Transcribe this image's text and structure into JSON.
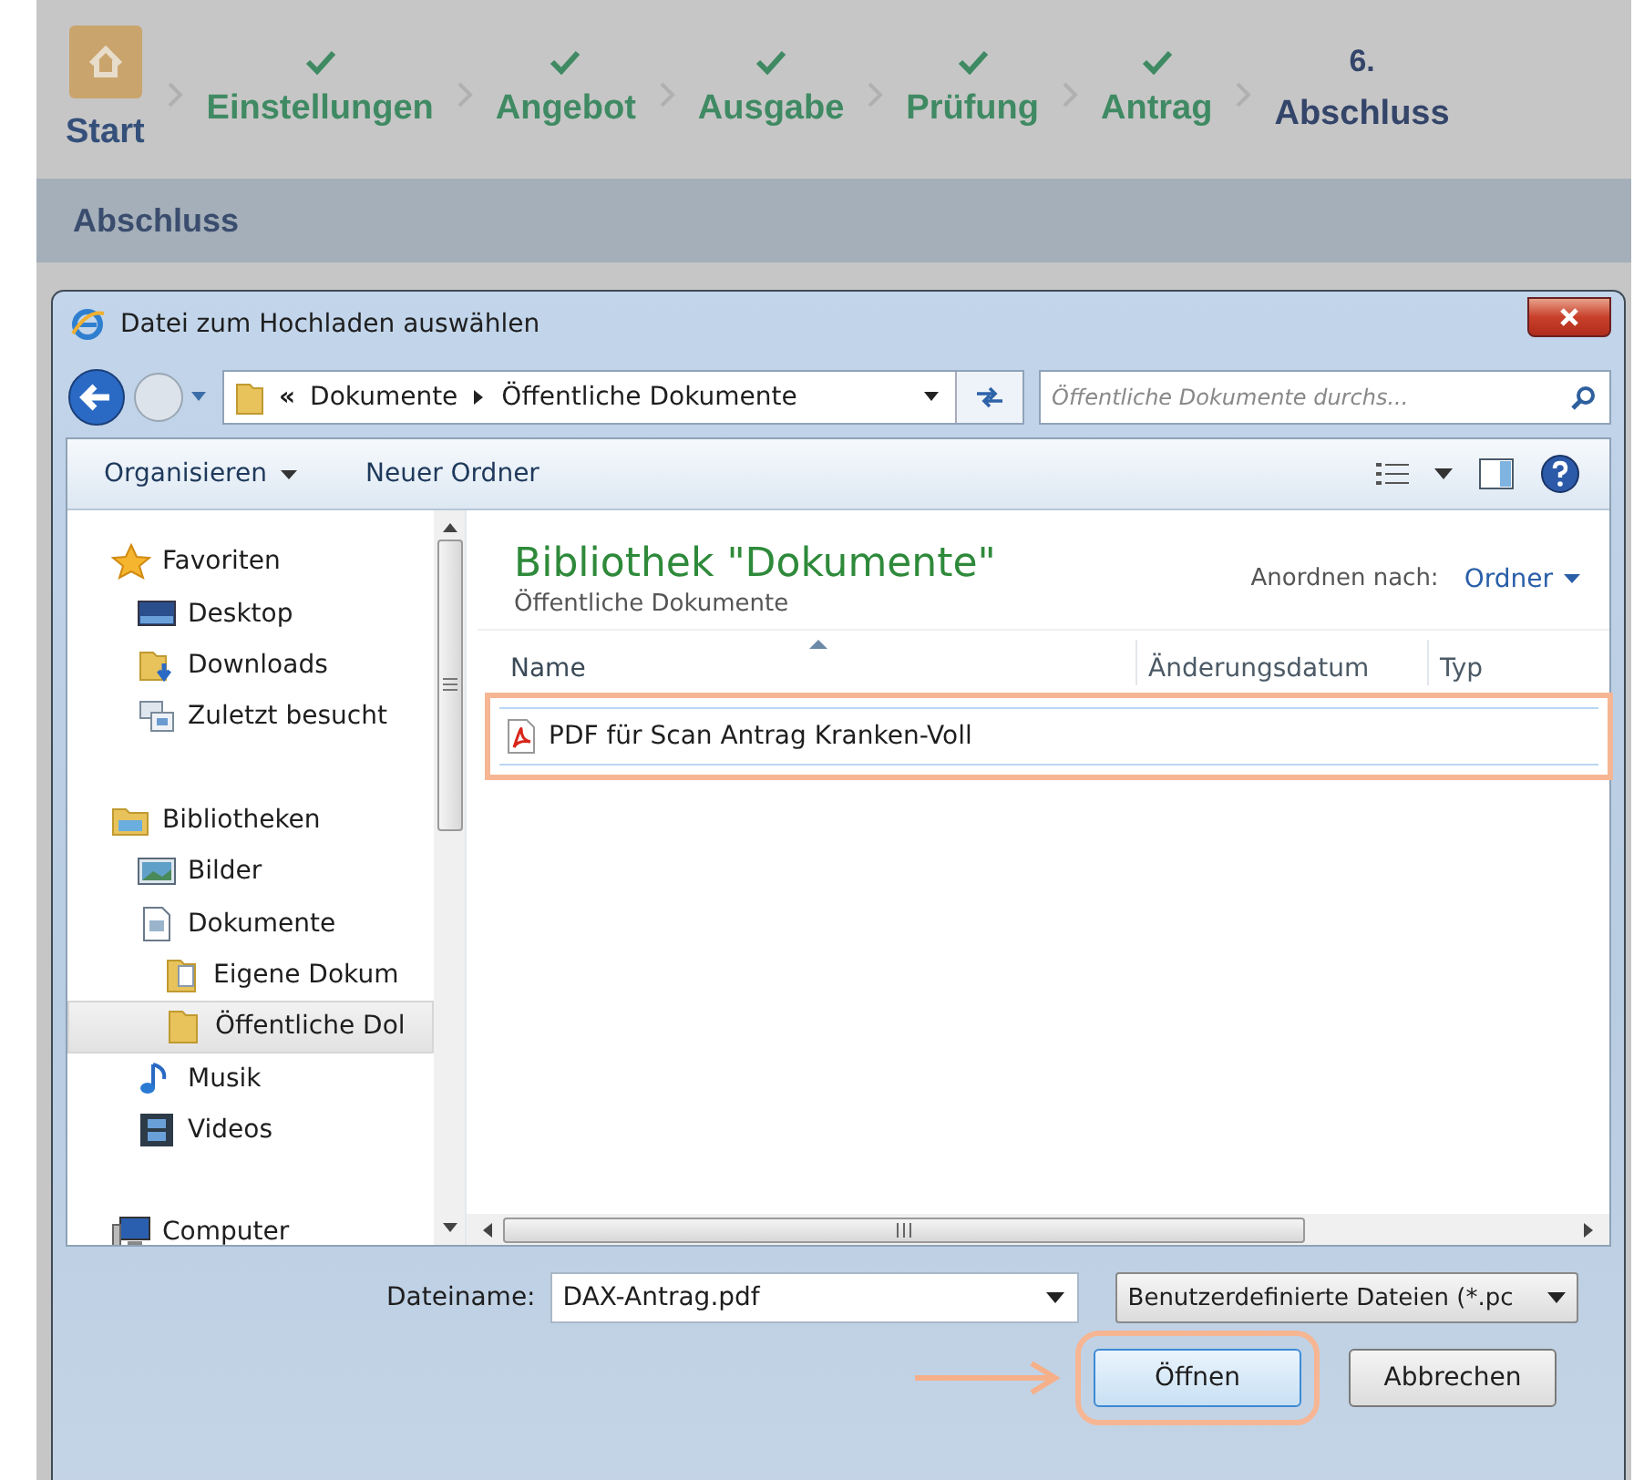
{
  "stepper": {
    "steps": [
      {
        "kind": "home",
        "label": "Start"
      },
      {
        "kind": "done",
        "label": "Einstellungen"
      },
      {
        "kind": "done",
        "label": "Angebot"
      },
      {
        "kind": "done",
        "label": "Ausgabe"
      },
      {
        "kind": "done",
        "label": "Prüfung"
      },
      {
        "kind": "done",
        "label": "Antrag"
      },
      {
        "kind": "current",
        "number": "6.",
        "label": "Abschluss"
      }
    ]
  },
  "section": {
    "title": "Abschluss"
  },
  "dialog": {
    "title": "Datei zum Hochladen auswählen",
    "address": {
      "overflow_mark": "«",
      "segments": [
        "Dokumente",
        "Öffentliche Dokumente"
      ]
    },
    "search": {
      "placeholder": "Öffentliche Dokumente durchs..."
    },
    "toolbar": {
      "organize": "Organisieren",
      "new_folder": "Neuer Ordner"
    },
    "nav": [
      {
        "label": "Favoriten",
        "selected": false,
        "children": [
          {
            "label": "Desktop",
            "selected": false
          },
          {
            "label": "Downloads",
            "selected": false
          },
          {
            "label": "Zuletzt besucht",
            "selected": false
          }
        ]
      },
      {
        "label": "Bibliotheken",
        "selected": false,
        "children": [
          {
            "label": "Bilder",
            "selected": false
          },
          {
            "label": "Dokumente",
            "selected": false,
            "children": [
              {
                "label": "Eigene Dokum",
                "selected": false
              },
              {
                "label": "Öffentliche Dol",
                "selected": true
              }
            ]
          },
          {
            "label": "Musik",
            "selected": false
          },
          {
            "label": "Videos",
            "selected": false
          }
        ]
      },
      {
        "label": "Computer",
        "selected": false
      }
    ],
    "library": {
      "title": "Bibliothek \"Dokumente\"",
      "subtitle": "Öffentliche Dokumente",
      "arrange_label": "Anordnen nach:",
      "arrange_value": "Ordner"
    },
    "columns": [
      {
        "label": "Name",
        "sorted": true
      },
      {
        "label": "Änderungsdatum",
        "sorted": false
      },
      {
        "label": "Typ",
        "sorted": false
      }
    ],
    "files": [
      {
        "name": "PDF für Scan Antrag Kranken-Voll",
        "highlighted": true
      }
    ],
    "filename": {
      "label": "Dateiname:",
      "value": "DAX-Antrag.pdf"
    },
    "filetype": {
      "value": "Benutzerdefinierte Dateien (*.pc"
    },
    "buttons": [
      {
        "label": "Öffnen",
        "highlighted": true
      },
      {
        "label": "Abbrechen",
        "highlighted": false
      }
    ]
  }
}
